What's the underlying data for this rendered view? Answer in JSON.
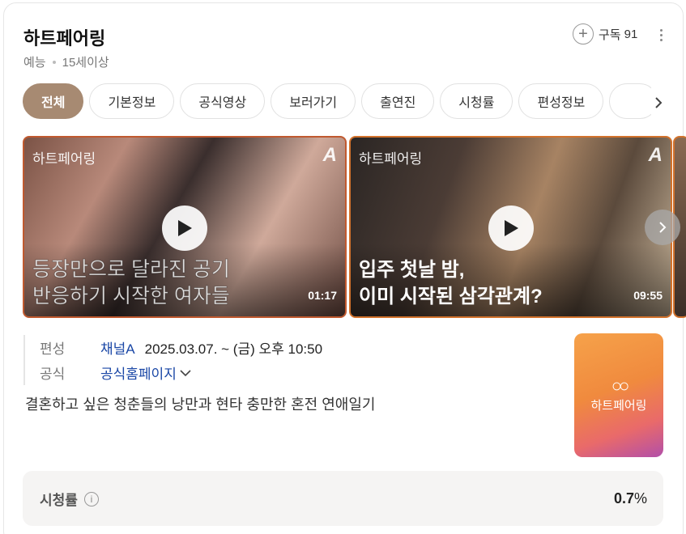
{
  "header": {
    "title": "하트페어링",
    "genre": "예능",
    "age_rating": "15세이상",
    "subscribe_label": "구독",
    "subscriber_count": "91"
  },
  "tabs": [
    {
      "label": "전체",
      "active": true
    },
    {
      "label": "기본정보",
      "active": false
    },
    {
      "label": "공식영상",
      "active": false
    },
    {
      "label": "보러가기",
      "active": false
    },
    {
      "label": "출연진",
      "active": false
    },
    {
      "label": "시청률",
      "active": false
    },
    {
      "label": "편성정보",
      "active": false
    },
    {
      "label": "",
      "active": false
    }
  ],
  "videos": [
    {
      "watermark": "하트페어링",
      "channel_logo": "A",
      "caption": "등장만으로 달라진 공기\n반응하기 시작한 여자들",
      "duration": "01:17"
    },
    {
      "watermark": "하트페어링",
      "channel_logo": "A",
      "caption": "입주 첫날 밤,\n이미 시작된 삼각관계?",
      "duration": "09:55"
    }
  ],
  "info": {
    "broadcast_label": "편성",
    "channel": "채널A",
    "schedule": "2025.03.07. ~  (금) 오후 10:50",
    "official_label": "공식",
    "official_link": "공식홈페이지"
  },
  "description": "결혼하고 싶은 청춘들의 낭만과 현타 충만한 혼전 연애일기",
  "poster": {
    "symbol": "○○",
    "title": "하트페어링"
  },
  "rating": {
    "label": "시청률",
    "value": "0.7",
    "unit": "%"
  },
  "colors": {
    "accent": "#a78a72",
    "link": "#1a47a6"
  }
}
